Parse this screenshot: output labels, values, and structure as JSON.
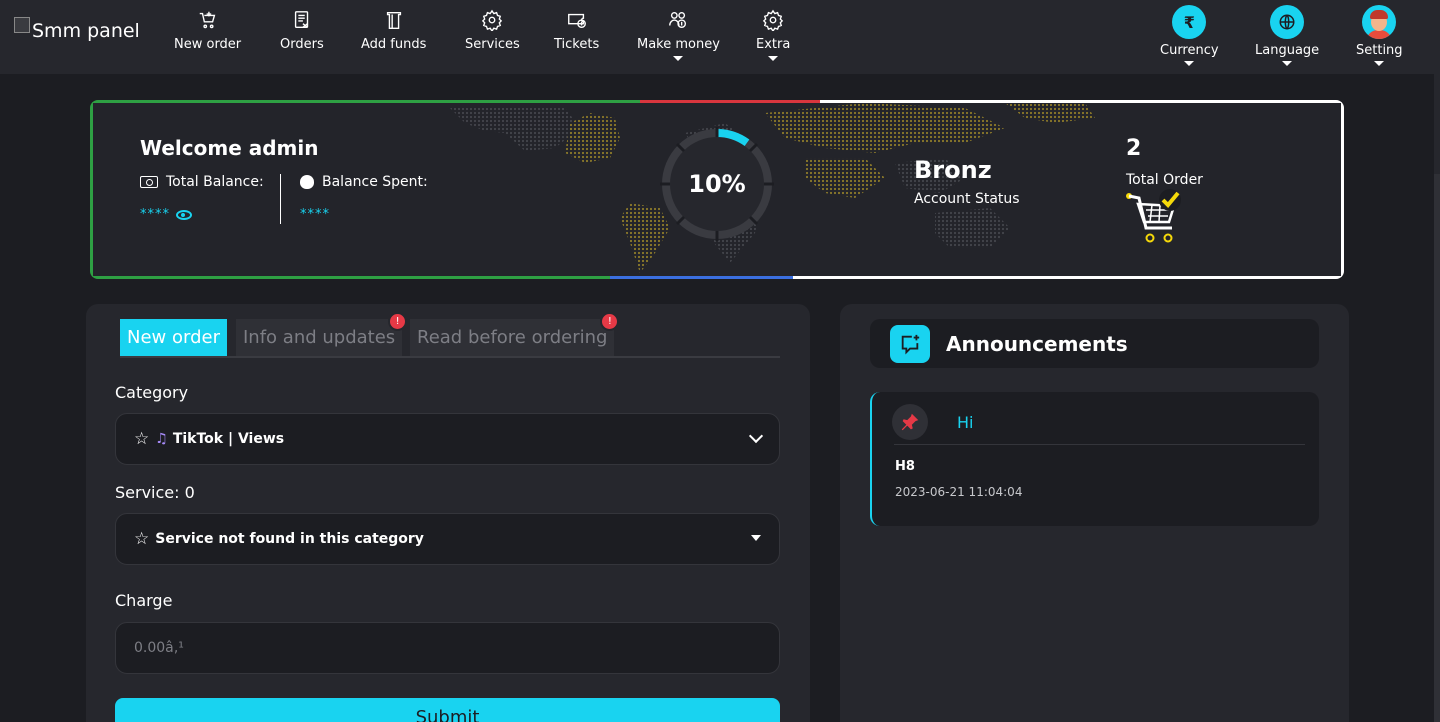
{
  "logo": {
    "alt_text": "Smm panel"
  },
  "nav": {
    "items": [
      {
        "label": "New order",
        "icon": "cart-add-icon"
      },
      {
        "label": "Orders",
        "icon": "receipt-icon"
      },
      {
        "label": "Add funds",
        "icon": "wallet-icon"
      },
      {
        "label": "Services",
        "icon": "gear-icon"
      },
      {
        "label": "Tickets",
        "icon": "ticket-icon"
      },
      {
        "label": "Make money",
        "icon": "affiliates-icon"
      },
      {
        "label": "Extra",
        "icon": "gear-icon"
      }
    ],
    "right": {
      "currency": {
        "label": "Currency",
        "symbol": "₹"
      },
      "language": {
        "label": "Language"
      },
      "setting": {
        "label": "Setting"
      }
    }
  },
  "welcome": {
    "title": "Welcome admin",
    "total_balance_label": "Total Balance:",
    "total_balance_value": "****",
    "balance_spent_label": "Balance Spent:",
    "balance_spent_value": "****",
    "progress_text": "10%",
    "progress_fraction": 0.1,
    "status_name": "Bronz",
    "status_label": "Account Status",
    "total_order_count": "2",
    "total_order_label": "Total Order"
  },
  "order_form": {
    "tabs": [
      {
        "label": "New order",
        "active": true
      },
      {
        "label": "Info and updates",
        "badge": "!"
      },
      {
        "label": "Read before ordering",
        "badge": "!"
      }
    ],
    "category_label": "Category",
    "category_value": "TikTok | Views",
    "service_label": "Service: 0",
    "service_value": "Service not found in this category",
    "charge_label": "Charge",
    "charge_placeholder": "0.00â‚¹",
    "submit_label": "Submit"
  },
  "announcements": {
    "title": "Announcements",
    "items": [
      {
        "author": "Hi",
        "body": "H8",
        "date": "2023-06-21 11:04:04"
      }
    ]
  },
  "colors": {
    "accent": "#19d3f0",
    "background": "#1c1d22",
    "panel": "#26272d",
    "badge": "#e63946"
  }
}
